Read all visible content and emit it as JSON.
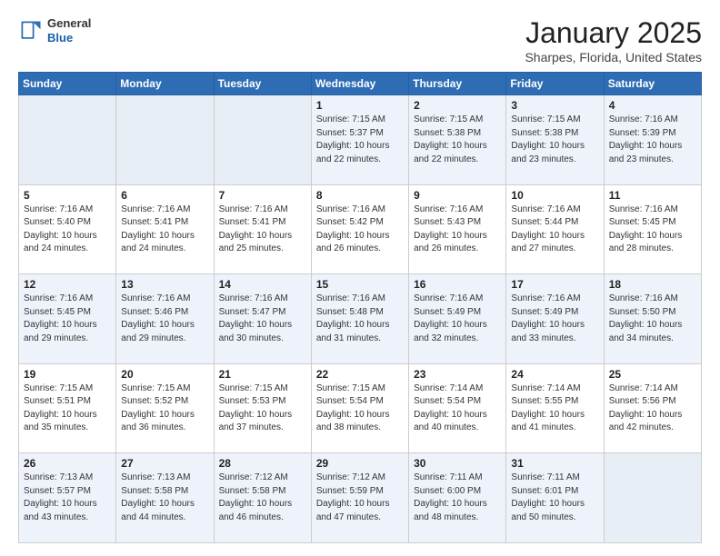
{
  "header": {
    "logo_general": "General",
    "logo_blue": "Blue",
    "month": "January 2025",
    "location": "Sharpes, Florida, United States"
  },
  "weekdays": [
    "Sunday",
    "Monday",
    "Tuesday",
    "Wednesday",
    "Thursday",
    "Friday",
    "Saturday"
  ],
  "weeks": [
    [
      {
        "day": "",
        "info": ""
      },
      {
        "day": "",
        "info": ""
      },
      {
        "day": "",
        "info": ""
      },
      {
        "day": "1",
        "info": "Sunrise: 7:15 AM\nSunset: 5:37 PM\nDaylight: 10 hours\nand 22 minutes."
      },
      {
        "day": "2",
        "info": "Sunrise: 7:15 AM\nSunset: 5:38 PM\nDaylight: 10 hours\nand 22 minutes."
      },
      {
        "day": "3",
        "info": "Sunrise: 7:15 AM\nSunset: 5:38 PM\nDaylight: 10 hours\nand 23 minutes."
      },
      {
        "day": "4",
        "info": "Sunrise: 7:16 AM\nSunset: 5:39 PM\nDaylight: 10 hours\nand 23 minutes."
      }
    ],
    [
      {
        "day": "5",
        "info": "Sunrise: 7:16 AM\nSunset: 5:40 PM\nDaylight: 10 hours\nand 24 minutes."
      },
      {
        "day": "6",
        "info": "Sunrise: 7:16 AM\nSunset: 5:41 PM\nDaylight: 10 hours\nand 24 minutes."
      },
      {
        "day": "7",
        "info": "Sunrise: 7:16 AM\nSunset: 5:41 PM\nDaylight: 10 hours\nand 25 minutes."
      },
      {
        "day": "8",
        "info": "Sunrise: 7:16 AM\nSunset: 5:42 PM\nDaylight: 10 hours\nand 26 minutes."
      },
      {
        "day": "9",
        "info": "Sunrise: 7:16 AM\nSunset: 5:43 PM\nDaylight: 10 hours\nand 26 minutes."
      },
      {
        "day": "10",
        "info": "Sunrise: 7:16 AM\nSunset: 5:44 PM\nDaylight: 10 hours\nand 27 minutes."
      },
      {
        "day": "11",
        "info": "Sunrise: 7:16 AM\nSunset: 5:45 PM\nDaylight: 10 hours\nand 28 minutes."
      }
    ],
    [
      {
        "day": "12",
        "info": "Sunrise: 7:16 AM\nSunset: 5:45 PM\nDaylight: 10 hours\nand 29 minutes."
      },
      {
        "day": "13",
        "info": "Sunrise: 7:16 AM\nSunset: 5:46 PM\nDaylight: 10 hours\nand 29 minutes."
      },
      {
        "day": "14",
        "info": "Sunrise: 7:16 AM\nSunset: 5:47 PM\nDaylight: 10 hours\nand 30 minutes."
      },
      {
        "day": "15",
        "info": "Sunrise: 7:16 AM\nSunset: 5:48 PM\nDaylight: 10 hours\nand 31 minutes."
      },
      {
        "day": "16",
        "info": "Sunrise: 7:16 AM\nSunset: 5:49 PM\nDaylight: 10 hours\nand 32 minutes."
      },
      {
        "day": "17",
        "info": "Sunrise: 7:16 AM\nSunset: 5:49 PM\nDaylight: 10 hours\nand 33 minutes."
      },
      {
        "day": "18",
        "info": "Sunrise: 7:16 AM\nSunset: 5:50 PM\nDaylight: 10 hours\nand 34 minutes."
      }
    ],
    [
      {
        "day": "19",
        "info": "Sunrise: 7:15 AM\nSunset: 5:51 PM\nDaylight: 10 hours\nand 35 minutes."
      },
      {
        "day": "20",
        "info": "Sunrise: 7:15 AM\nSunset: 5:52 PM\nDaylight: 10 hours\nand 36 minutes."
      },
      {
        "day": "21",
        "info": "Sunrise: 7:15 AM\nSunset: 5:53 PM\nDaylight: 10 hours\nand 37 minutes."
      },
      {
        "day": "22",
        "info": "Sunrise: 7:15 AM\nSunset: 5:54 PM\nDaylight: 10 hours\nand 38 minutes."
      },
      {
        "day": "23",
        "info": "Sunrise: 7:14 AM\nSunset: 5:54 PM\nDaylight: 10 hours\nand 40 minutes."
      },
      {
        "day": "24",
        "info": "Sunrise: 7:14 AM\nSunset: 5:55 PM\nDaylight: 10 hours\nand 41 minutes."
      },
      {
        "day": "25",
        "info": "Sunrise: 7:14 AM\nSunset: 5:56 PM\nDaylight: 10 hours\nand 42 minutes."
      }
    ],
    [
      {
        "day": "26",
        "info": "Sunrise: 7:13 AM\nSunset: 5:57 PM\nDaylight: 10 hours\nand 43 minutes."
      },
      {
        "day": "27",
        "info": "Sunrise: 7:13 AM\nSunset: 5:58 PM\nDaylight: 10 hours\nand 44 minutes."
      },
      {
        "day": "28",
        "info": "Sunrise: 7:12 AM\nSunset: 5:58 PM\nDaylight: 10 hours\nand 46 minutes."
      },
      {
        "day": "29",
        "info": "Sunrise: 7:12 AM\nSunset: 5:59 PM\nDaylight: 10 hours\nand 47 minutes."
      },
      {
        "day": "30",
        "info": "Sunrise: 7:11 AM\nSunset: 6:00 PM\nDaylight: 10 hours\nand 48 minutes."
      },
      {
        "day": "31",
        "info": "Sunrise: 7:11 AM\nSunset: 6:01 PM\nDaylight: 10 hours\nand 50 minutes."
      },
      {
        "day": "",
        "info": ""
      }
    ]
  ]
}
